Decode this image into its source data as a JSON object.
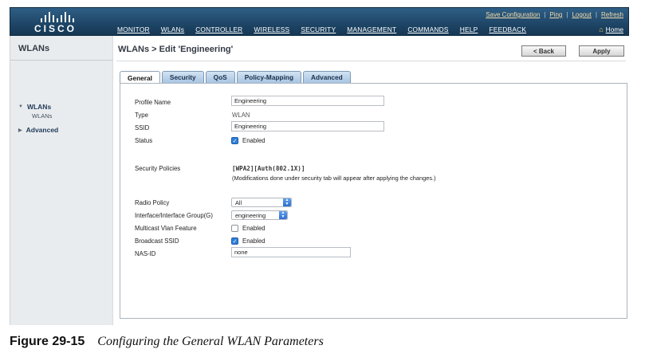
{
  "header": {
    "logo_text": "CISCO",
    "util_links": [
      "Save Configuration",
      "Ping",
      "Logout",
      "Refresh"
    ],
    "nav": [
      "MONITOR",
      "WLANs",
      "CONTROLLER",
      "WIRELESS",
      "SECURITY",
      "MANAGEMENT",
      "COMMANDS",
      "HELP",
      "FEEDBACK"
    ],
    "active_nav": "WLANs",
    "home_label": "Home",
    "colors": {
      "bar": "#1e4566",
      "util_link": "#f3dcaa",
      "home_icon": "#f2c34a"
    }
  },
  "sidebar": {
    "title": "WLANs",
    "items": [
      {
        "label": "WLANs",
        "expanded": true,
        "children": [
          "WLANs"
        ]
      },
      {
        "label": "Advanced",
        "expanded": false
      }
    ]
  },
  "page": {
    "title": "WLANs > Edit  'Engineering'",
    "back_label": "< Back",
    "apply_label": "Apply",
    "tabs": [
      "General",
      "Security",
      "QoS",
      "Policy-Mapping",
      "Advanced"
    ],
    "active_tab": "General"
  },
  "form": {
    "profile_name": {
      "label": "Profile Name",
      "value": "Engineering"
    },
    "type": {
      "label": "Type",
      "value": "WLAN"
    },
    "ssid": {
      "label": "SSID",
      "value": "Engineering"
    },
    "status": {
      "label": "Status",
      "checked": true,
      "text": "Enabled"
    },
    "security_policies": {
      "label": "Security Policies",
      "value": "[WPA2][Auth(802.1X)]",
      "note": "(Modifications done under security tab will appear after applying the changes.)"
    },
    "radio_policy": {
      "label": "Radio Policy",
      "value": "All"
    },
    "interface": {
      "label": "Interface/Interface Group(G)",
      "value": "engineering"
    },
    "multicast_vlan": {
      "label": "Multicast Vlan Feature",
      "checked": false,
      "text": "Enabled"
    },
    "broadcast_ssid": {
      "label": "Broadcast SSID",
      "checked": true,
      "text": "Enabled"
    },
    "nas_id": {
      "label": "NAS-ID",
      "value": "none"
    }
  },
  "caption": {
    "number": "Figure 29-15",
    "text": "Configuring the General WLAN Parameters"
  }
}
